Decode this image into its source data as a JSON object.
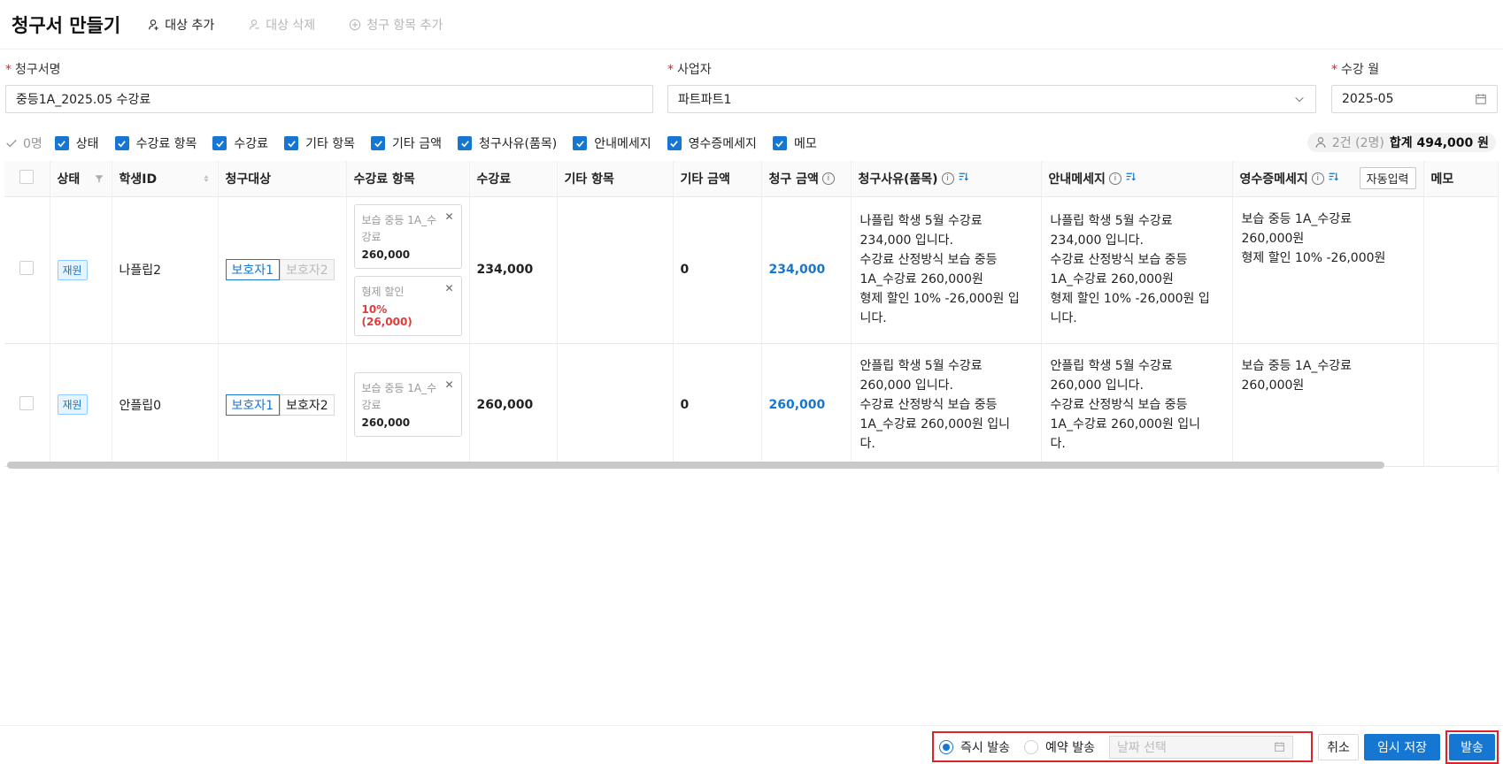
{
  "header": {
    "title": "청구서 만들기",
    "add_target": "대상 추가",
    "delete_target": "대상 삭제",
    "add_item": "청구 항목 추가"
  },
  "form": {
    "invoice_name": {
      "label": "청구서명",
      "value": "중등1A_2025.05 수강료"
    },
    "business": {
      "label": "사업자",
      "value": "파트파트1"
    },
    "month": {
      "label": "수강 월",
      "value": "2025-05"
    }
  },
  "columns_bar": {
    "selected_count": "0명",
    "toggles": [
      "상태",
      "수강료 항목",
      "수강료",
      "기타 항목",
      "기타 금액",
      "청구사유(품목)",
      "안내메세지",
      "영수증메세지",
      "메모"
    ],
    "summary_count": "2건 (2명)",
    "summary_total": "합계 494,000 원"
  },
  "table": {
    "headers": {
      "status": "상태",
      "student_id": "학생ID",
      "target": "청구대상",
      "fee_items": "수강료 항목",
      "fee": "수강료",
      "other_items": "기타 항목",
      "other_amount": "기타 금액",
      "bill_amount": "청구 금액",
      "reason": "청구사유(품목)",
      "notice": "안내메세지",
      "receipt": "영수증메세지",
      "auto_input": "자동입력",
      "memo": "메모"
    },
    "rows": [
      {
        "status": "재원",
        "student_id": "나플립2",
        "guardian1": "보호자1",
        "guardian2": "보호자2",
        "items": [
          {
            "name": "보습 중등 1A_수강료",
            "amount": "260,000"
          },
          {
            "name": "형제 할인",
            "amount": "10% (26,000)"
          }
        ],
        "fee": "234,000",
        "other_amount": "0",
        "bill": "234,000",
        "reason": "나플립 학생 5월 수강료\n234,000 입니다.\n수강료 산정방식 보습 중등\n1A_수강료 260,000원\n형제 할인 10% -26,000원 입\n니다.",
        "notice": "나플립 학생 5월 수강료\n234,000 입니다.\n수강료 산정방식 보습 중등\n1A_수강료 260,000원\n형제 할인 10% -26,000원 입\n니다.",
        "receipt": "보습 중등 1A_수강료\n260,000원\n형제 할인 10% -26,000원"
      },
      {
        "status": "재원",
        "student_id": "안플립0",
        "guardian1": "보호자1",
        "guardian2": "보호자2",
        "items": [
          {
            "name": "보습 중등 1A_수강료",
            "amount": "260,000"
          }
        ],
        "fee": "260,000",
        "other_amount": "0",
        "bill": "260,000",
        "reason": "안플립 학생 5월 수강료\n260,000 입니다.\n수강료 산정방식 보습 중등\n1A_수강료 260,000원 입니\n다.",
        "notice": "안플립 학생 5월 수강료\n260,000 입니다.\n수강료 산정방식 보습 중등\n1A_수강료 260,000원 입니\n다.",
        "receipt": "보습 중등 1A_수강료\n260,000원"
      }
    ]
  },
  "footer": {
    "immediate": "즉시 발송",
    "scheduled": "예약 발송",
    "date_placeholder": "날짜 선택",
    "cancel": "취소",
    "temp_save": "임시 저장",
    "send": "발송"
  },
  "colors": {
    "accent": "#1677d2",
    "highlight": "#d9242c",
    "discount": "#e03c3c"
  }
}
